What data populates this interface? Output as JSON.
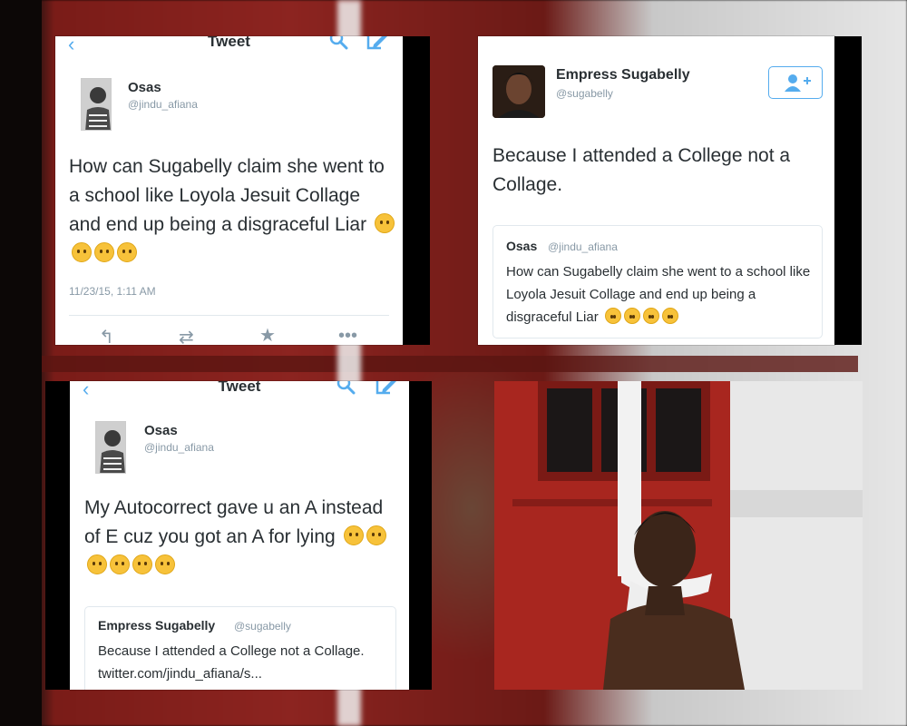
{
  "panel_top_left": {
    "title": "Tweet",
    "author": {
      "name": "Osas",
      "handle": "@jindu_afiana"
    },
    "text": "How can Sugabelly claim she went to a school like Loyola Jesuit Collage and end up being a disgraceful Liar",
    "timestamp": "11/23/15, 1:11 AM",
    "emoji_count": 4,
    "icons": [
      "back-icon",
      "search-icon",
      "compose-icon",
      "reply-icon",
      "retweet-icon",
      "favorite-icon",
      "more-icon"
    ]
  },
  "panel_top_right": {
    "author": {
      "name": "Empress Sugabelly",
      "handle": "@sugabelly"
    },
    "text": "Because I attended a College not a Collage.",
    "quoted": {
      "name": "Osas",
      "handle": "@jindu_afiana",
      "text": "How can Sugabelly claim she went to a school like Loyola Jesuit Collage and end up being a disgraceful Liar",
      "emoji_count": 4
    },
    "icons": [
      "follow-icon"
    ]
  },
  "panel_bottom_left": {
    "title": "Tweet",
    "author": {
      "name": "Osas",
      "handle": "@jindu_afiana"
    },
    "text": "My Autocorrect gave u an A instead of E cuz you got an A for lying",
    "emoji_count": 6,
    "quoted": {
      "name": "Empress Sugabelly",
      "handle": "@sugabelly",
      "text": "Because I attended a College not a Collage. twitter.com/jindu_afiana/s..."
    }
  },
  "colors": {
    "twitter_blue": "#55acee",
    "text_dark": "#292f33",
    "text_muted": "#8899a6",
    "door_red": "#a52720"
  }
}
